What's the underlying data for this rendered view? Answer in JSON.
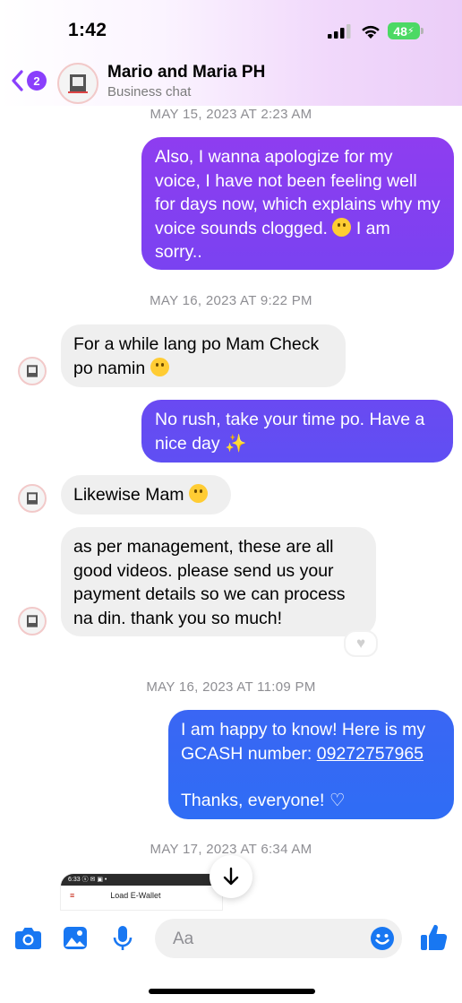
{
  "status": {
    "time": "1:42",
    "battery": "48"
  },
  "header": {
    "back_count": "2",
    "title": "Mario and Maria PH",
    "subtitle": "Business chat"
  },
  "messages": {
    "ts1": "MAY 15, 2023 AT 2:23 AM",
    "m1": "Also, I wanna apologize for my voice, I have not been feeling well for days now, which explains why my voice sounds clogged.",
    "m1_tail": "I am sorry..",
    "ts2": "MAY 16, 2023 AT 9:22 PM",
    "m2": "For a while lang po Mam Check po namin",
    "m3": "No rush, take your time po. Have a nice day",
    "m4": "Likewise Mam",
    "m5": "as per management, these are all good videos.  please send us your payment details so we can process na din. thank you so much!",
    "ts3": "MAY 16, 2023 AT 11:09 PM",
    "m6_line1": "I am happy to know! Here is my",
    "m6_prefix": "GCASH number: ",
    "m6_number": "09272757965",
    "m6_thanks": "Thanks, everyone! ♡",
    "ts4": "MAY 17, 2023 AT 6:34 AM"
  },
  "attachment": {
    "status_text": "6:33 ⓢ ✉ ▣ •",
    "title": "Load E-Wallet"
  },
  "composer": {
    "placeholder": "Aa"
  },
  "colors": {
    "outgoing_top": "#8e3df0",
    "outgoing_mid": "#6a4af2",
    "outgoing_bottom": "#2f6df5",
    "incoming": "#efefef",
    "accent": "#1877f2"
  },
  "icons": [
    "back-chevron-icon",
    "camera-icon",
    "photo-icon",
    "microphone-icon",
    "emoji-icon",
    "thumbs-up-icon",
    "arrow-down-icon"
  ]
}
